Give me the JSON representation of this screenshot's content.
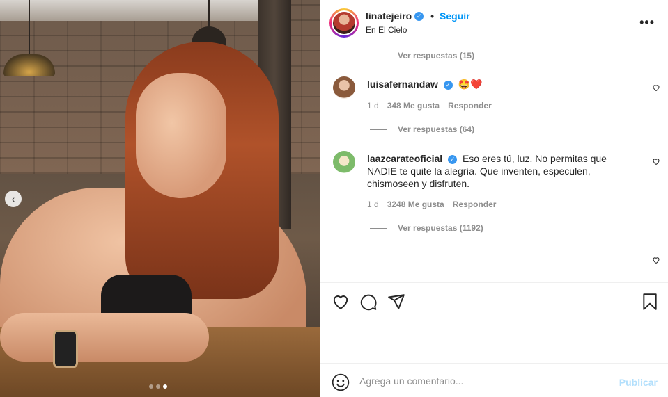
{
  "post": {
    "username": "linatejeiro",
    "verified": true,
    "separator": "•",
    "follow_label": "Seguir",
    "location": "En El Cielo",
    "more_label": "•••"
  },
  "carousel": {
    "prev_label": "‹",
    "dot_count": 3,
    "active_index": 2
  },
  "comments": {
    "top_replies": "Ver respuestas (15)",
    "items": [
      {
        "user": "luisafernandaw",
        "text": "",
        "emoji": "🤩❤️",
        "time": "1 d",
        "likes": "348 Me gusta",
        "reply_label": "Responder",
        "replies": "Ver respuestas (64)"
      },
      {
        "user": "laazcarateoficial",
        "text": "Eso eres tú, luz. No permitas que NADIE te quite la alegría. Que inventen, especulen, chismoseen y disfruten.",
        "emoji": "",
        "time": "1 d",
        "likes": "3248 Me gusta",
        "reply_label": "Responder",
        "replies": "Ver respuestas (1192)"
      }
    ]
  },
  "composer": {
    "placeholder": "Agrega un comentario...",
    "publish_label": "Publicar"
  },
  "colors": {
    "accent": "#0095f6",
    "publish_disabled": "#b2dffc",
    "secondary_text": "#8e8e8e"
  }
}
